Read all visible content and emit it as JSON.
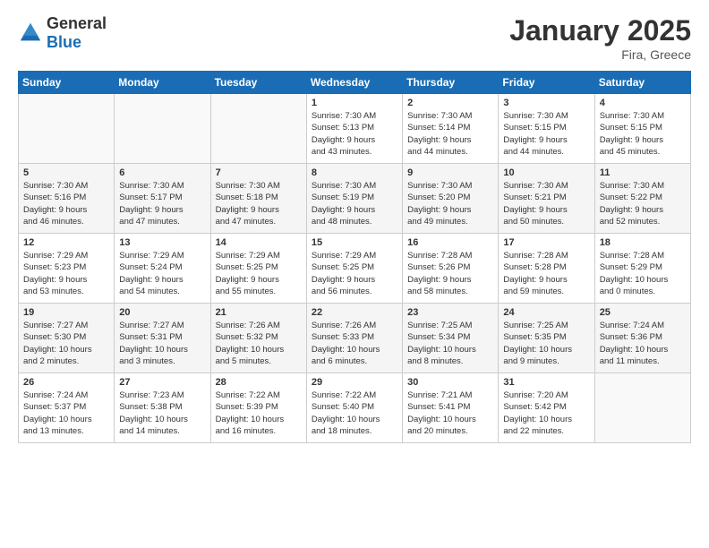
{
  "header": {
    "logo_general": "General",
    "logo_blue": "Blue",
    "month_title": "January 2025",
    "location": "Fira, Greece"
  },
  "weekdays": [
    "Sunday",
    "Monday",
    "Tuesday",
    "Wednesday",
    "Thursday",
    "Friday",
    "Saturday"
  ],
  "weeks": [
    [
      {
        "day": "",
        "info": ""
      },
      {
        "day": "",
        "info": ""
      },
      {
        "day": "",
        "info": ""
      },
      {
        "day": "1",
        "info": "Sunrise: 7:30 AM\nSunset: 5:13 PM\nDaylight: 9 hours\nand 43 minutes."
      },
      {
        "day": "2",
        "info": "Sunrise: 7:30 AM\nSunset: 5:14 PM\nDaylight: 9 hours\nand 44 minutes."
      },
      {
        "day": "3",
        "info": "Sunrise: 7:30 AM\nSunset: 5:15 PM\nDaylight: 9 hours\nand 44 minutes."
      },
      {
        "day": "4",
        "info": "Sunrise: 7:30 AM\nSunset: 5:15 PM\nDaylight: 9 hours\nand 45 minutes."
      }
    ],
    [
      {
        "day": "5",
        "info": "Sunrise: 7:30 AM\nSunset: 5:16 PM\nDaylight: 9 hours\nand 46 minutes."
      },
      {
        "day": "6",
        "info": "Sunrise: 7:30 AM\nSunset: 5:17 PM\nDaylight: 9 hours\nand 47 minutes."
      },
      {
        "day": "7",
        "info": "Sunrise: 7:30 AM\nSunset: 5:18 PM\nDaylight: 9 hours\nand 47 minutes."
      },
      {
        "day": "8",
        "info": "Sunrise: 7:30 AM\nSunset: 5:19 PM\nDaylight: 9 hours\nand 48 minutes."
      },
      {
        "day": "9",
        "info": "Sunrise: 7:30 AM\nSunset: 5:20 PM\nDaylight: 9 hours\nand 49 minutes."
      },
      {
        "day": "10",
        "info": "Sunrise: 7:30 AM\nSunset: 5:21 PM\nDaylight: 9 hours\nand 50 minutes."
      },
      {
        "day": "11",
        "info": "Sunrise: 7:30 AM\nSunset: 5:22 PM\nDaylight: 9 hours\nand 52 minutes."
      }
    ],
    [
      {
        "day": "12",
        "info": "Sunrise: 7:29 AM\nSunset: 5:23 PM\nDaylight: 9 hours\nand 53 minutes."
      },
      {
        "day": "13",
        "info": "Sunrise: 7:29 AM\nSunset: 5:24 PM\nDaylight: 9 hours\nand 54 minutes."
      },
      {
        "day": "14",
        "info": "Sunrise: 7:29 AM\nSunset: 5:25 PM\nDaylight: 9 hours\nand 55 minutes."
      },
      {
        "day": "15",
        "info": "Sunrise: 7:29 AM\nSunset: 5:25 PM\nDaylight: 9 hours\nand 56 minutes."
      },
      {
        "day": "16",
        "info": "Sunrise: 7:28 AM\nSunset: 5:26 PM\nDaylight: 9 hours\nand 58 minutes."
      },
      {
        "day": "17",
        "info": "Sunrise: 7:28 AM\nSunset: 5:28 PM\nDaylight: 9 hours\nand 59 minutes."
      },
      {
        "day": "18",
        "info": "Sunrise: 7:28 AM\nSunset: 5:29 PM\nDaylight: 10 hours\nand 0 minutes."
      }
    ],
    [
      {
        "day": "19",
        "info": "Sunrise: 7:27 AM\nSunset: 5:30 PM\nDaylight: 10 hours\nand 2 minutes."
      },
      {
        "day": "20",
        "info": "Sunrise: 7:27 AM\nSunset: 5:31 PM\nDaylight: 10 hours\nand 3 minutes."
      },
      {
        "day": "21",
        "info": "Sunrise: 7:26 AM\nSunset: 5:32 PM\nDaylight: 10 hours\nand 5 minutes."
      },
      {
        "day": "22",
        "info": "Sunrise: 7:26 AM\nSunset: 5:33 PM\nDaylight: 10 hours\nand 6 minutes."
      },
      {
        "day": "23",
        "info": "Sunrise: 7:25 AM\nSunset: 5:34 PM\nDaylight: 10 hours\nand 8 minutes."
      },
      {
        "day": "24",
        "info": "Sunrise: 7:25 AM\nSunset: 5:35 PM\nDaylight: 10 hours\nand 9 minutes."
      },
      {
        "day": "25",
        "info": "Sunrise: 7:24 AM\nSunset: 5:36 PM\nDaylight: 10 hours\nand 11 minutes."
      }
    ],
    [
      {
        "day": "26",
        "info": "Sunrise: 7:24 AM\nSunset: 5:37 PM\nDaylight: 10 hours\nand 13 minutes."
      },
      {
        "day": "27",
        "info": "Sunrise: 7:23 AM\nSunset: 5:38 PM\nDaylight: 10 hours\nand 14 minutes."
      },
      {
        "day": "28",
        "info": "Sunrise: 7:22 AM\nSunset: 5:39 PM\nDaylight: 10 hours\nand 16 minutes."
      },
      {
        "day": "29",
        "info": "Sunrise: 7:22 AM\nSunset: 5:40 PM\nDaylight: 10 hours\nand 18 minutes."
      },
      {
        "day": "30",
        "info": "Sunrise: 7:21 AM\nSunset: 5:41 PM\nDaylight: 10 hours\nand 20 minutes."
      },
      {
        "day": "31",
        "info": "Sunrise: 7:20 AM\nSunset: 5:42 PM\nDaylight: 10 hours\nand 22 minutes."
      },
      {
        "day": "",
        "info": ""
      }
    ]
  ]
}
